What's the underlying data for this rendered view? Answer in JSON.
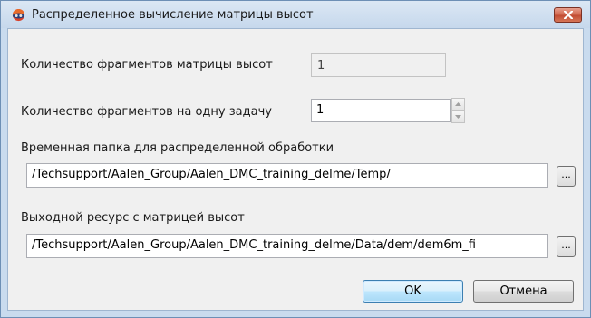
{
  "window": {
    "title": "Распределенное вычисление матрицы высот"
  },
  "fields": {
    "fragments_count_label": "Количество фрагментов матрицы высот",
    "fragments_count_value": "1",
    "fragments_per_task_label": "Количество фрагментов на одну задачу",
    "fragments_per_task_value": "1",
    "temp_folder_label": "Временная папка для распределенной обработки",
    "temp_folder_value": "/Techsupport/Aalen_Group/Aalen_DMC_training_delme/Temp/",
    "output_resource_label": "Выходной ресурс с матрицей высот",
    "output_resource_value": "/Techsupport/Aalen_Group/Aalen_DMC_training_delme/Data/dem/dem6m_fi"
  },
  "buttons": {
    "browse": "...",
    "ok": "OK",
    "cancel": "Отмена"
  },
  "icons": {
    "app": "app-logo-icon",
    "close": "close-icon",
    "spin_up": "spin-up-icon",
    "spin_down": "spin-down-icon"
  },
  "colors": {
    "title_bar": "#c6d8ec",
    "close_button": "#c24d34",
    "dialog_body": "#f0f0f0",
    "default_button": "#bee6fd"
  }
}
